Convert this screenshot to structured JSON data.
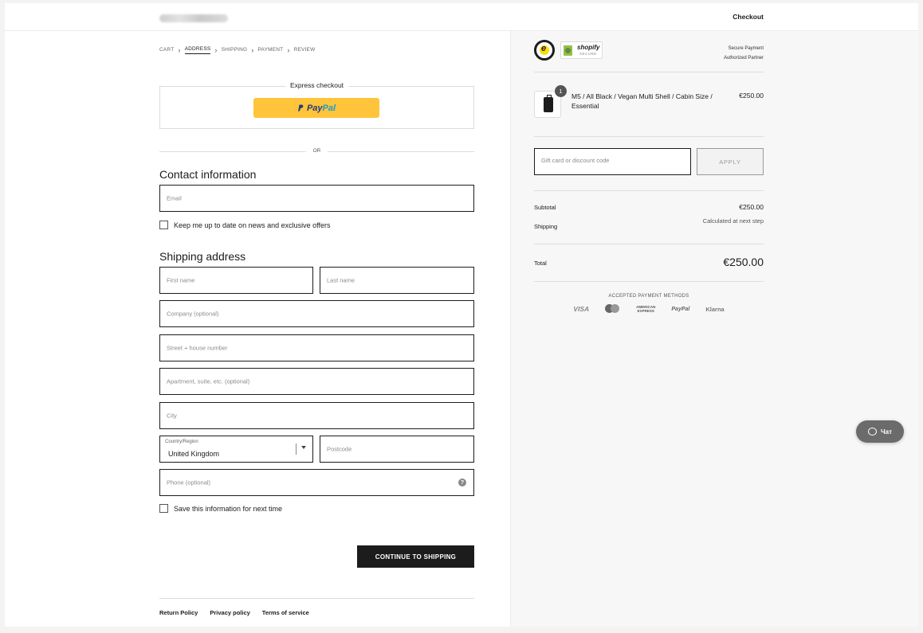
{
  "header": {
    "title": "Checkout"
  },
  "breadcrumb": [
    "CART",
    "ADDRESS",
    "SHIPPING",
    "PAYMENT",
    "REVIEW"
  ],
  "express": {
    "title": "Express checkout",
    "paypal_p": "Pay",
    "paypal_al": "Pal"
  },
  "or_text": "OR",
  "contact": {
    "title": "Contact information",
    "email_placeholder": "Email",
    "newsletter_label": "Keep me up to date on news and exclusive offers"
  },
  "shipping": {
    "title": "Shipping address",
    "first_name": "First name",
    "last_name": "Last name",
    "company": "Company (optional)",
    "street": "Street + house number",
    "apartment": "Apartment, suite, etc. (optional)",
    "city": "City",
    "country_label": "Country/Region",
    "country_value": "United Kingdom",
    "postcode": "Postcode",
    "phone": "Phone (optional)",
    "help_glyph": "?",
    "save_label": "Save this information for next time"
  },
  "continue_label": "CONTINUE TO SHIPPING",
  "footer": {
    "links": [
      "Return Policy",
      "Privacy policy",
      "Terms of service"
    ]
  },
  "summary": {
    "trusted_glyph": "e",
    "shopify_label": "shopify",
    "shopify_sub": "SECURE",
    "secure_line1": "Secure Payment",
    "secure_line2": "Authorized Partner",
    "product": {
      "name": "M5 / All Black / Vegan Multi Shell / Cabin Size / Essential",
      "price": "€250.00",
      "quantity": "1"
    },
    "discount_placeholder": "Gift card or discount code",
    "apply_label": "APPLY",
    "subtotal_label": "Subtotal",
    "subtotal_value": "€250.00",
    "shipping_label": "Shipping",
    "shipping_value": "Calculated at next step",
    "total_label": "Total",
    "total_value": "€250.00",
    "payment_methods_title": "ACCEPTED PAYMENT METHODS",
    "payment_methods": {
      "visa": "VISA",
      "amex_line1": "AMERICAN",
      "amex_line2": "EXPRESS",
      "paypal": "PayPal",
      "klarna": "Klarna"
    }
  },
  "chat": {
    "label": "Чат"
  },
  "colors": {
    "accent": "#1c1c1c",
    "paypal_yellow": "#ffc439",
    "summary_bg": "#f7f7f7"
  }
}
